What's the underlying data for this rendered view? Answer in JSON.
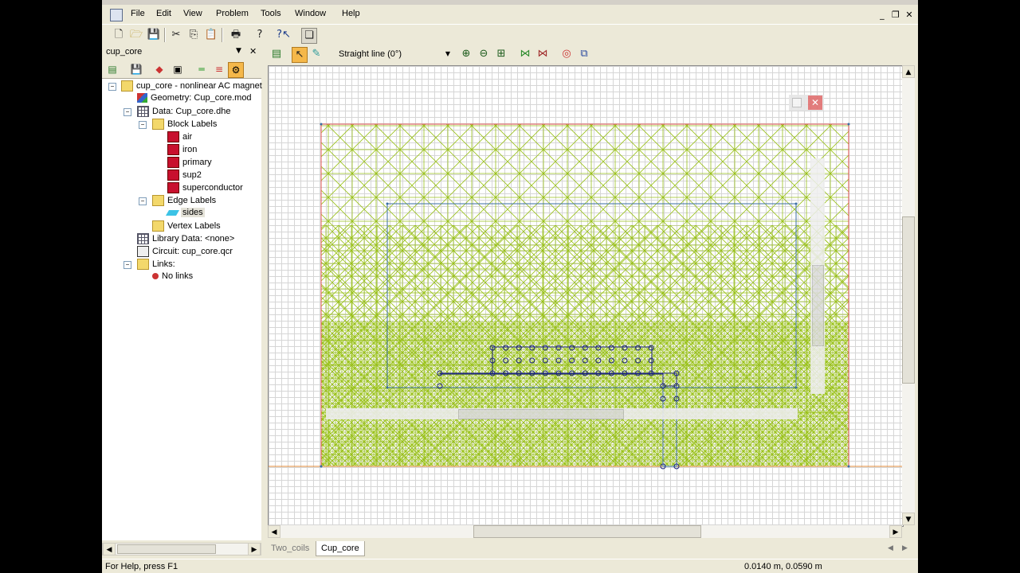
{
  "menu": {
    "file": "File",
    "edit": "Edit",
    "view": "View",
    "problem": "Problem",
    "tools": "Tools",
    "window": "Window",
    "help": "Help"
  },
  "mdi_buttons": {
    "minimize": "_",
    "restore": "❐",
    "close": "✕"
  },
  "pane": {
    "title": "cup_core"
  },
  "tree": {
    "root": "cup_core - nonlinear AC magnet",
    "geometry": "Geometry: Cup_core.mod",
    "data": "Data: Cup_core.dhe",
    "block_labels": "Block Labels",
    "blocks": [
      "air",
      "iron",
      "primary",
      "sup2",
      "superconductor"
    ],
    "edge_labels": "Edge Labels",
    "edge_items": [
      "sides"
    ],
    "vertex_labels": "Vertex Labels",
    "library": "Library Data: <none>",
    "circuit": "Circuit: cup_core.qcr",
    "links": "Links:",
    "no_links": "No links"
  },
  "work_toolbar": {
    "combo_value": "Straight line (0°)"
  },
  "tabs": [
    "Two_coils",
    "Cup_core"
  ],
  "active_tab": 1,
  "status": {
    "help": "For Help, press F1",
    "coords": "0.0140 m, 0.0590 m"
  },
  "colors": {
    "mesh": "#9ac21a",
    "outer_boundary": "#e05050",
    "inner_boundary": "#3a6ea5",
    "vertex": "#1a237e"
  }
}
